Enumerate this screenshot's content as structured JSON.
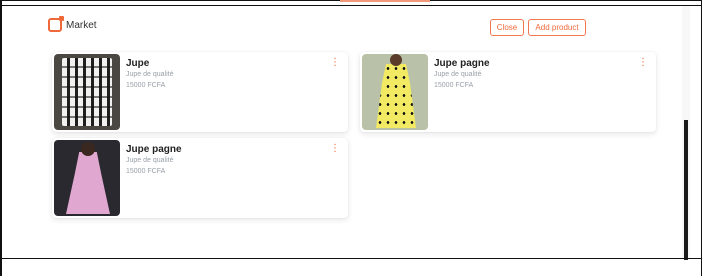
{
  "header": {
    "title": "Market",
    "icon": "store-icon",
    "accent_color": "#ef6a3a"
  },
  "actions": {
    "close_label": "Close",
    "add_label": "Add product"
  },
  "products": [
    {
      "name": "Jupe",
      "category": "Jupe de qualité",
      "price": "15000 FCFA"
    },
    {
      "name": "Jupe pagne",
      "category": "Jupe de qualité",
      "price": "15000 FCFA"
    },
    {
      "name": "Jupe pagne",
      "category": "Jupe de qualité",
      "price": "15000 FCFA"
    }
  ]
}
